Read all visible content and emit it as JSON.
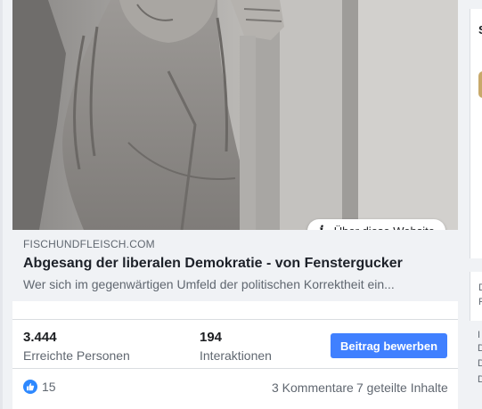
{
  "post": {
    "image_alt": "Steinskulptur eines Mannes mit langen Haaren",
    "site_info_label": "Über diese Website",
    "link": {
      "domain": "FISCHUNDFLEISCH.COM",
      "title": "Abgesang der liberalen Demokratie - von Fenstergucker",
      "description": "Wer sich im gegenwärtigen Umfeld der politischen Korrektheit ein..."
    },
    "insights": {
      "reach_value": "3.444",
      "reach_label": "Erreichte Personen",
      "interactions_value": "194",
      "interactions_label": "Interaktionen",
      "boost_label": "Beitrag bewerben"
    },
    "footer": {
      "like_count": "15",
      "comments": "3 Kommentare",
      "shares": "7 geteilte Inhalte"
    }
  },
  "right_column": {
    "top_letter": "S",
    "mid_letter_1": "D",
    "mid_letter_2": "F",
    "bottom_letters": [
      "I",
      "D",
      "D",
      "D"
    ]
  },
  "colors": {
    "accent": "#4080ff",
    "like": "#2d88ff",
    "background": "#f0f2f5"
  }
}
